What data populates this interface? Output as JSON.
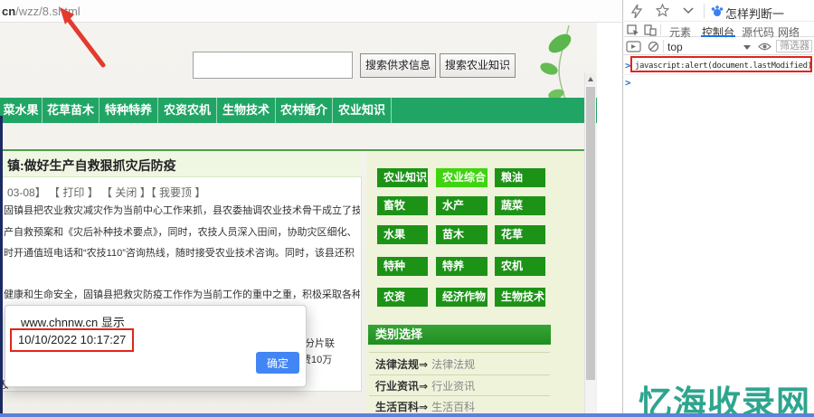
{
  "browser": {
    "url_prefix": "cn",
    "url_path": "/wzz/8.shtml",
    "bookmark_title": "怎样判断一"
  },
  "search": {
    "value": "",
    "button1": "搜索供求信息",
    "button2": "搜索农业知识"
  },
  "nav": {
    "items": [
      "菜水果",
      "花草苗木",
      "特种特养",
      "农资农机",
      "生物技术",
      "农村婚介",
      "农业知识"
    ]
  },
  "article": {
    "title": "镇:做好生产自救狠抓灾后防疫",
    "meta": "03-08】 【 打印 】 【 关闭 】【 我要顶 】",
    "lines": [
      "固镇县把农业救灾减灾作为当前中心工作来抓，县农委抽调农业技术骨干成立了技",
      "产自救预案和《灾后补种技术要点》，同时，农技人员深入田间，协助灾区细化、",
      "时开通值班电话和“农技110”咨询热线，随时接受农业技术咨询。同时，该县还积",
      "健康和生命安全，固镇县把救灾防疫工作作为当前工作的重中之重，积极采取各种"
    ],
    "fragments": {
      "right1": "分片联",
      "right2": "费10万",
      "left1": "及"
    }
  },
  "sidebar": {
    "grid": [
      "农业知识",
      "农业综合",
      "粮油",
      "畜牧",
      "水产",
      "蔬菜",
      "水果",
      "苗木",
      "花草",
      "特种",
      "特养",
      "农机",
      "农资",
      "经济作物",
      "生物技术"
    ],
    "active_item": "农业综合",
    "header": "类别选择",
    "links": [
      {
        "category": "法律法规",
        "arrow": "⇒",
        "link": "法律法规"
      },
      {
        "category": "行业资讯",
        "arrow": "⇒",
        "link": "行业资讯"
      },
      {
        "category": "生活百科",
        "arrow": "⇒",
        "link": "生活百科"
      }
    ]
  },
  "dialog": {
    "title": "www.chnnw.cn 显示",
    "message": "10/10/2022 10:17:27",
    "ok_label": "确定"
  },
  "devtools": {
    "tabs": [
      "元素",
      "控制台",
      "源代码",
      "网络"
    ],
    "active_tab": "控制台",
    "context": "top",
    "filter_label": "筛选器",
    "prompt": ">",
    "console_input": "javascript:alert(document.lastModified)"
  },
  "watermark": "忆海收录网",
  "colors": {
    "nav_green": "#21a565",
    "grid_green": "#1c9317",
    "grid_active_green": "#3fd410",
    "annotation_red": "#e0251b",
    "ok_blue": "#4285f4",
    "devtools_blue": "#1a73e8",
    "watermark_teal": "#2ea58e",
    "bottom_blue": "#5b82d8",
    "navy_edge": "#1c2a63"
  }
}
